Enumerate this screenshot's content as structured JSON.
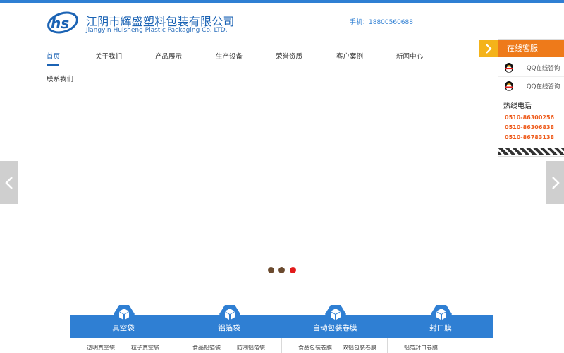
{
  "header": {
    "company_cn": "江阴市辉盛塑料包装有限公司",
    "company_en": "Jiangyin Huisheng Plastic Packaging Co. LTD.",
    "phone": "手机：18800560688",
    "logo_text": "hs"
  },
  "nav": {
    "items": [
      "首页",
      "关于我们",
      "产品展示",
      "生产设备",
      "荣誉资质",
      "客户案例",
      "新闻中心",
      "联系我们"
    ],
    "active_index": 0
  },
  "slider": {
    "dot_count": 3,
    "active_dot": 2,
    "prev_icon": "chevron-left-icon",
    "next_icon": "chevron-right-icon"
  },
  "kefu": {
    "title": "在线客服",
    "qq": [
      "QQ在线咨询",
      "QQ在线咨询"
    ],
    "hotline_label": "热线电话",
    "numbers": [
      "0510-86300256",
      "0510-86306838",
      "0510-86783138"
    ]
  },
  "categories": [
    {
      "title": "真空袋",
      "links": [
        "透明真空袋",
        "粒子真空袋"
      ]
    },
    {
      "title": "铝箔袋",
      "links": [
        "食品铝箔袋",
        "防潮铝箔袋"
      ]
    },
    {
      "title": "自动包装卷膜",
      "links": [
        "食品包装卷膜",
        "双铝包装卷膜"
      ]
    },
    {
      "title": "封口膜",
      "links": [
        "铝箔封口卷膜"
      ]
    }
  ],
  "colors": {
    "primary": "#2f7fd3",
    "orange": "#ee7a1a",
    "yellow": "#f4b31a",
    "dot_inactive": "#6b4a2e",
    "dot_active": "#e21b1b"
  }
}
